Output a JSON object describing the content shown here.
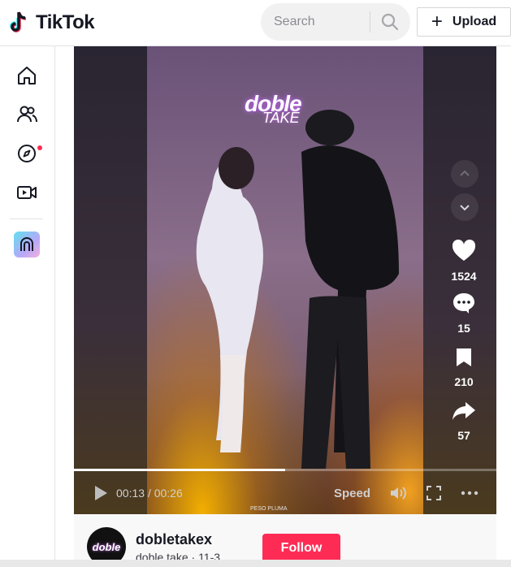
{
  "header": {
    "logo_text": "TikTok",
    "search_placeholder": "Search",
    "upload_label": "Upload"
  },
  "sidebar": {
    "items": [
      {
        "name": "home-icon"
      },
      {
        "name": "following-icon"
      },
      {
        "name": "explore-icon",
        "notification": true
      },
      {
        "name": "live-icon"
      }
    ]
  },
  "video": {
    "watermark": "doble",
    "watermark_sub": "TAKE",
    "small_caption": "PESO PLUMA",
    "progress": 0.5,
    "time_current": "00:13",
    "time_separator": "/",
    "time_total": "00:26",
    "speed_label": "Speed"
  },
  "actions": {
    "likes": "1524",
    "comments": "15",
    "saves": "210",
    "shares": "57"
  },
  "author": {
    "username": "dobletakex",
    "display_name": "doble take",
    "meta_separator": "·",
    "date": "11-3",
    "follow_label": "Follow",
    "avatar_text": "doble"
  },
  "colors": {
    "brand_red": "#fe2c55",
    "text": "#161823"
  }
}
